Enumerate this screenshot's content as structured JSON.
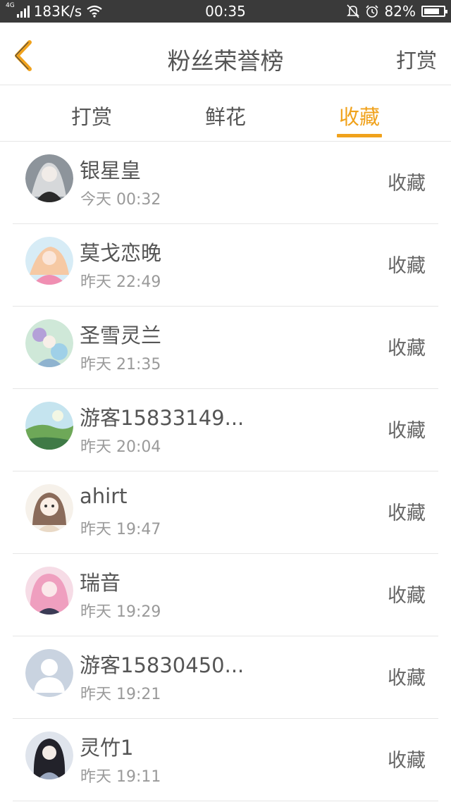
{
  "status_bar": {
    "network_type": "4G",
    "speed": "183K/s",
    "time": "00:35",
    "battery_percent": "82%",
    "battery_level": 0.82,
    "icons": [
      "signal-icon",
      "wifi-icon",
      "mute-bell-icon",
      "alarm-icon",
      "battery-icon"
    ]
  },
  "header": {
    "back_icon": "chevron-left-icon",
    "title": "粉丝荣誉榜",
    "action": "打赏"
  },
  "tabs": [
    {
      "label": "打赏",
      "active": false
    },
    {
      "label": "鲜花",
      "active": false
    },
    {
      "label": "收藏",
      "active": true
    }
  ],
  "colors": {
    "accent": "#f0a21c",
    "status_bar": "#3a3a3a",
    "divider": "#e6e6e6"
  },
  "fans": [
    {
      "name": "银星皇",
      "time": "今天 00:32",
      "action": "收藏",
      "avatar_colors": [
        "#2f2f2f",
        "#9aa0a6"
      ]
    },
    {
      "name": "莫戈恋晚",
      "time": "昨天 22:49",
      "action": "收藏",
      "avatar_colors": [
        "#f3b5c8",
        "#cfe3f2"
      ]
    },
    {
      "name": "圣雪灵兰",
      "time": "昨天 21:35",
      "action": "收藏",
      "avatar_colors": [
        "#c8e6c9",
        "#b39ddb"
      ]
    },
    {
      "name": "游客15833149...",
      "time": "昨天 20:04",
      "action": "收藏",
      "avatar_colors": [
        "#7fb86a",
        "#c5e4ef"
      ]
    },
    {
      "name": "ahirt",
      "time": "昨天 19:47",
      "action": "收藏",
      "avatar_colors": [
        "#f4ede4",
        "#8a6b5a"
      ]
    },
    {
      "name": "瑞音",
      "time": "昨天 19:29",
      "action": "收藏",
      "avatar_colors": [
        "#f2a9c6",
        "#3b3b55"
      ]
    },
    {
      "name": "游客15830450...",
      "time": "昨天 19:21",
      "action": "收藏",
      "avatar_colors": [
        "#c9d3e0",
        "#ffffff"
      ]
    },
    {
      "name": "灵竹1",
      "time": "昨天 19:11",
      "action": "收藏",
      "avatar_colors": [
        "#2b2b33",
        "#b9c3d6"
      ]
    }
  ]
}
